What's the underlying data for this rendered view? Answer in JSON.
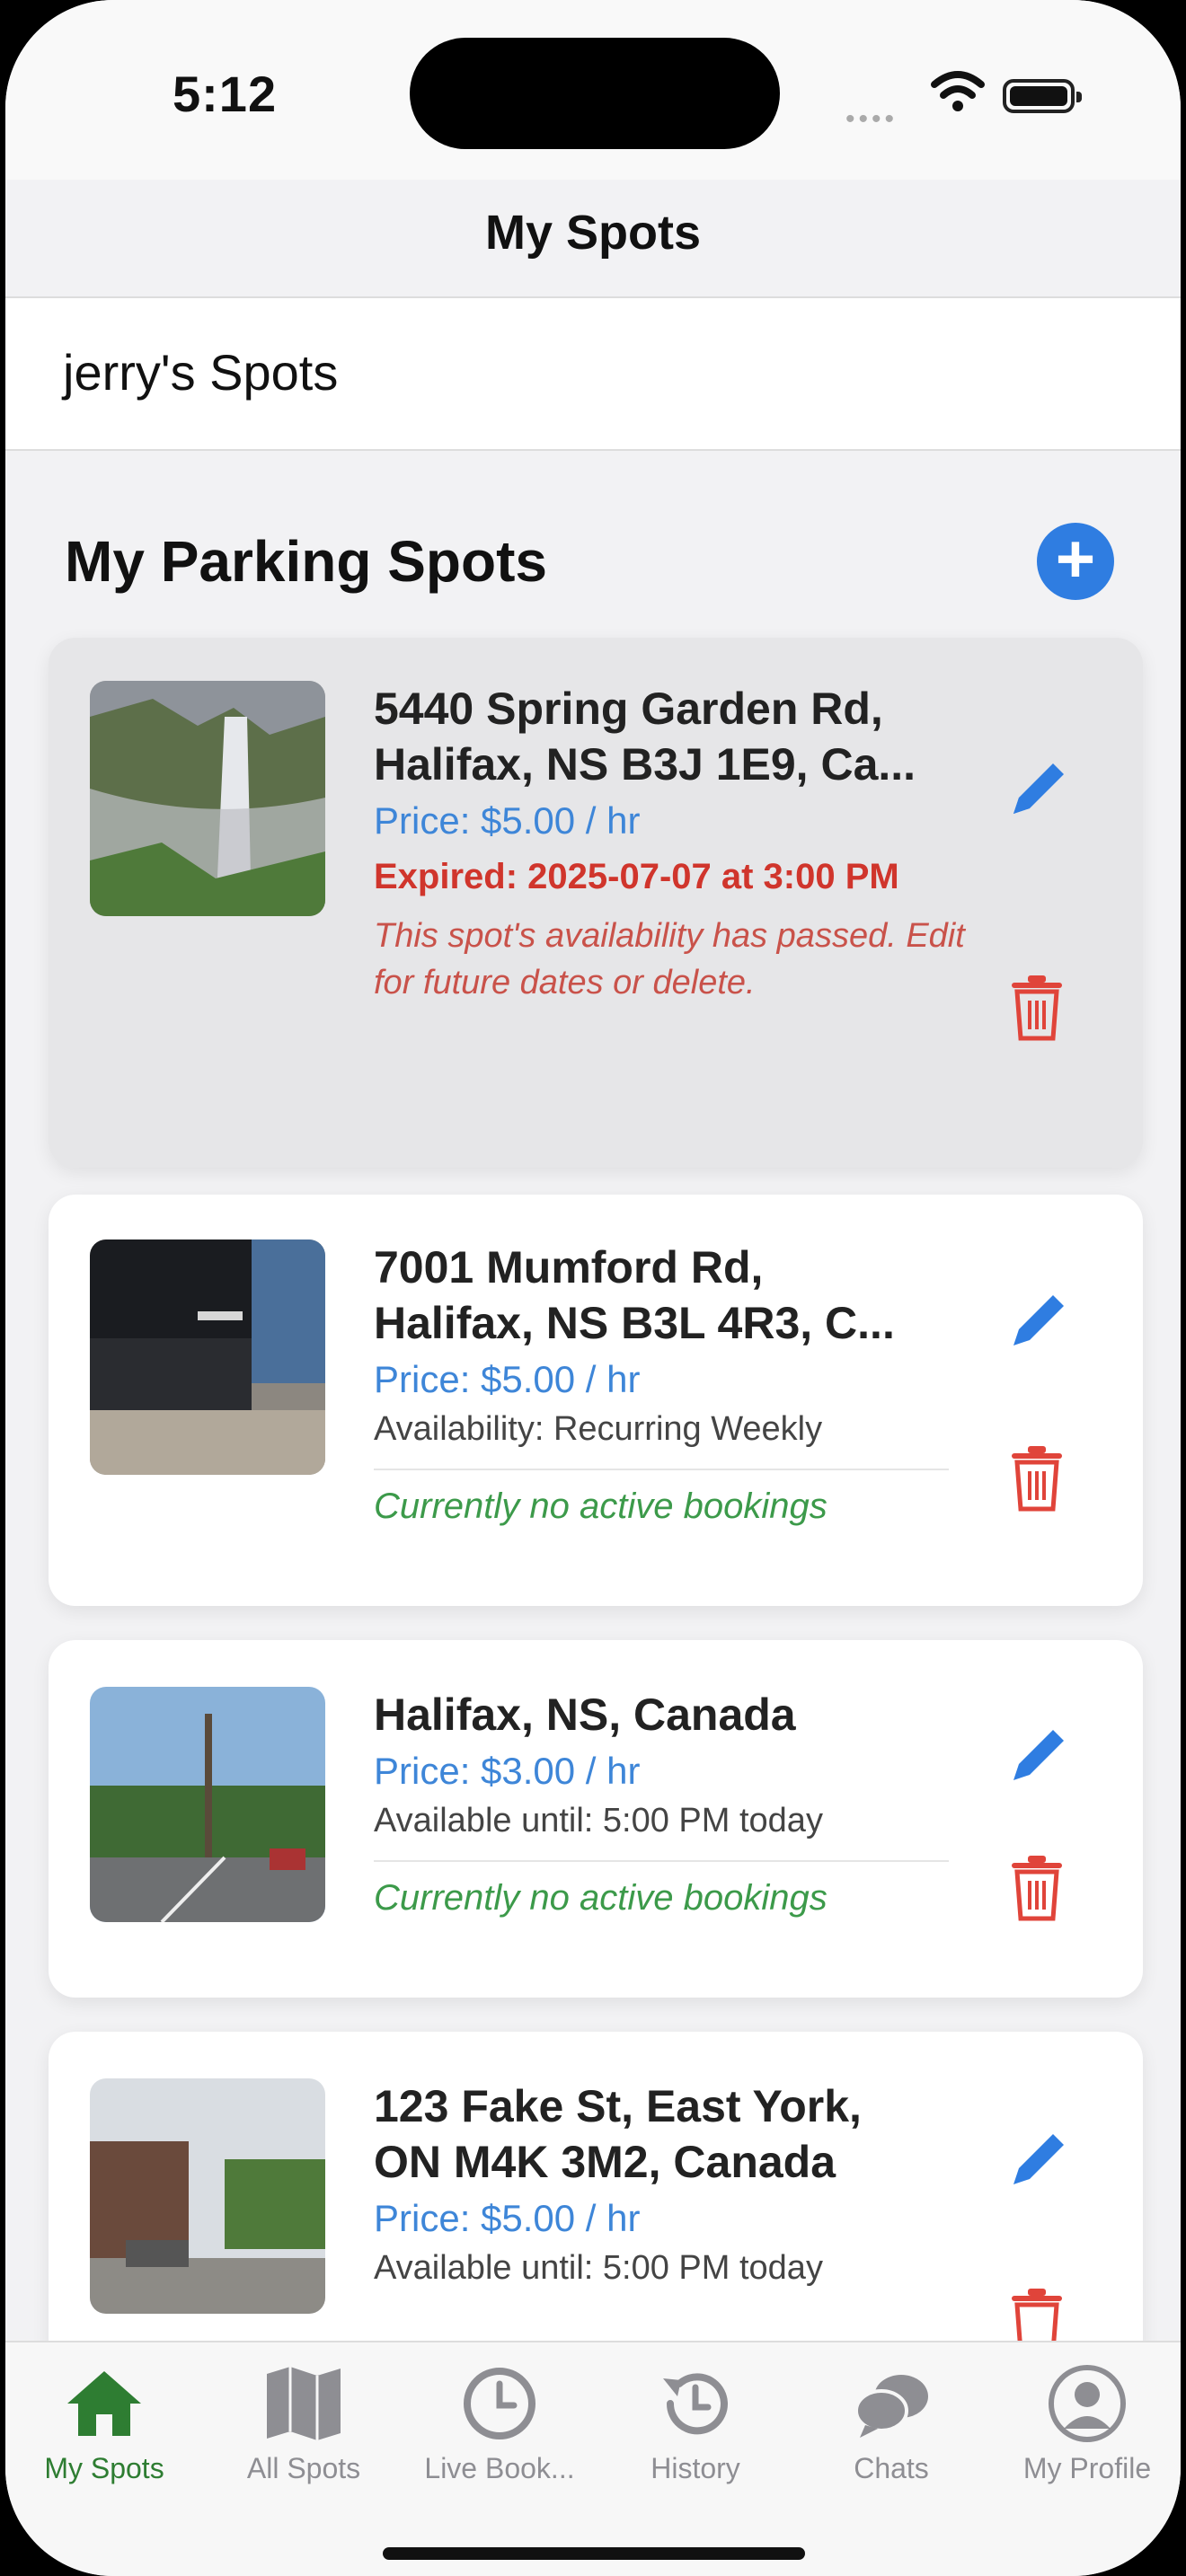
{
  "status_bar": {
    "time": "5:12"
  },
  "nav": {
    "title": "My Spots"
  },
  "owner": {
    "title": "jerry's Spots"
  },
  "section": {
    "title": "My Parking Spots",
    "add_label": "+"
  },
  "spots": [
    {
      "address_line1": "5440 Spring Garden Rd,",
      "address_line2": "Halifax, NS B3J 1E9, Ca...",
      "price": "Price: $5.00 / hr",
      "expired": "Expired: 2025-07-07 at 3:00 PM",
      "expired_note": "This spot's availability has passed. Edit for future dates or delete."
    },
    {
      "address_line1": "7001 Mumford Rd,",
      "address_line2": "Halifax, NS B3L 4R3, C...",
      "price": "Price: $5.00 / hr",
      "availability": "Availability: Recurring Weekly",
      "bookings": "Currently no active bookings"
    },
    {
      "address_line1": "Halifax, NS, Canada",
      "price": "Price: $3.00 / hr",
      "availability": "Available until: 5:00 PM today",
      "bookings": "Currently no active bookings"
    },
    {
      "address_line1": "123 Fake St, East York,",
      "address_line2": "ON M4K 3M2, Canada",
      "price": "Price: $5.00 / hr",
      "availability": "Available until: 5:00 PM today"
    }
  ],
  "tabs": [
    {
      "label": "My Spots",
      "icon": "home-icon",
      "active": true
    },
    {
      "label": "All Spots",
      "icon": "map-icon"
    },
    {
      "label": "Live Book...",
      "icon": "clock-icon"
    },
    {
      "label": "History",
      "icon": "history-icon"
    },
    {
      "label": "Chats",
      "icon": "chat-icon"
    },
    {
      "label": "My Profile",
      "icon": "profile-icon"
    }
  ],
  "colors": {
    "accent": "#2f7de1",
    "price": "#3e86d8",
    "expired": "#d0352c",
    "success": "#3c9a4a",
    "active_tab": "#2e7d32"
  }
}
